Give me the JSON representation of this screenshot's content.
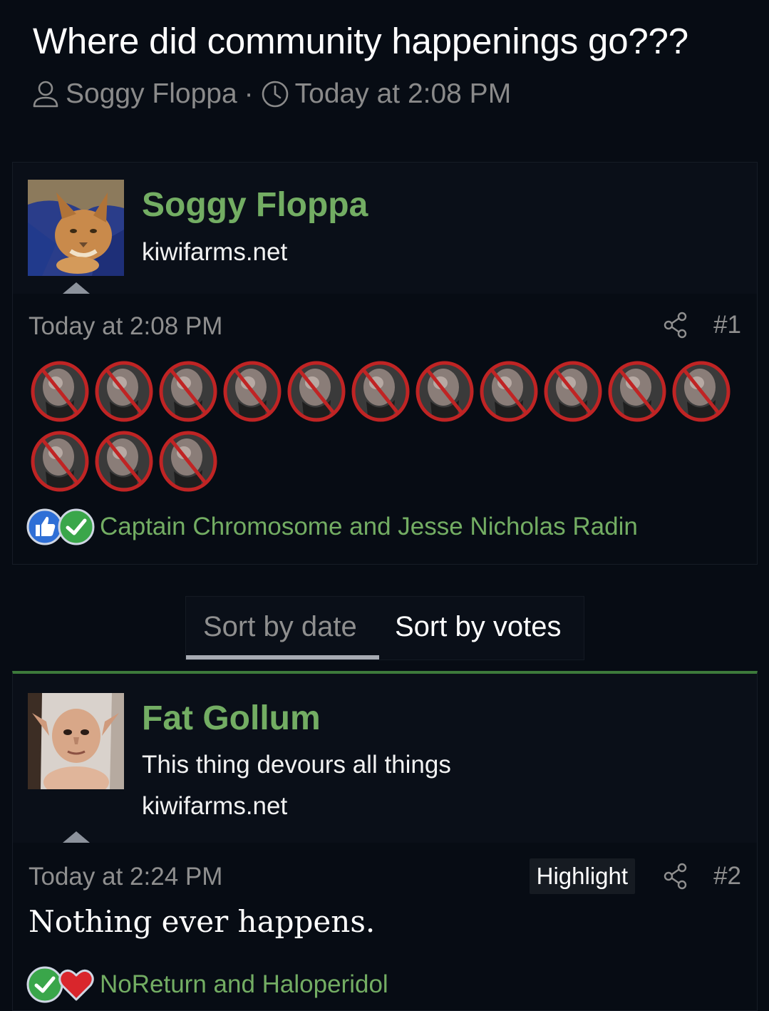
{
  "thread": {
    "title": "Where did community happenings go???",
    "author": "Soggy Floppa",
    "separator": "·",
    "date": "Today at 2:08 PM"
  },
  "posts": [
    {
      "username": "Soggy Floppa",
      "user_lines": [
        "kiwifarms.net"
      ],
      "date": "Today at 2:08 PM",
      "number": "#1",
      "emoji_count": 14,
      "emoji_icon": "no-trump-emoji-icon",
      "reactions": [
        "like-icon",
        "agree-icon"
      ],
      "reaction_names": "Captain Chromosome and Jesse Nicholas Radin"
    },
    {
      "username": "Fat Gollum",
      "user_lines": [
        "This thing devours all things",
        "kiwifarms.net"
      ],
      "date": "Today at 2:24 PM",
      "highlight_label": "Highlight",
      "number": "#2",
      "message": "Nothing ever happens.",
      "reactions": [
        "agree-icon",
        "love-icon"
      ],
      "reaction_names": "NoReturn and Haloperidol"
    }
  ],
  "sort": {
    "tabs": [
      {
        "label": "Sort by date",
        "active": true
      },
      {
        "label": "Sort by votes",
        "active": false
      }
    ]
  },
  "colors": {
    "background": "#070c14",
    "username_green": "#73ad63",
    "accent_border": "#3d7a3b",
    "muted": "#8f8f8f"
  }
}
